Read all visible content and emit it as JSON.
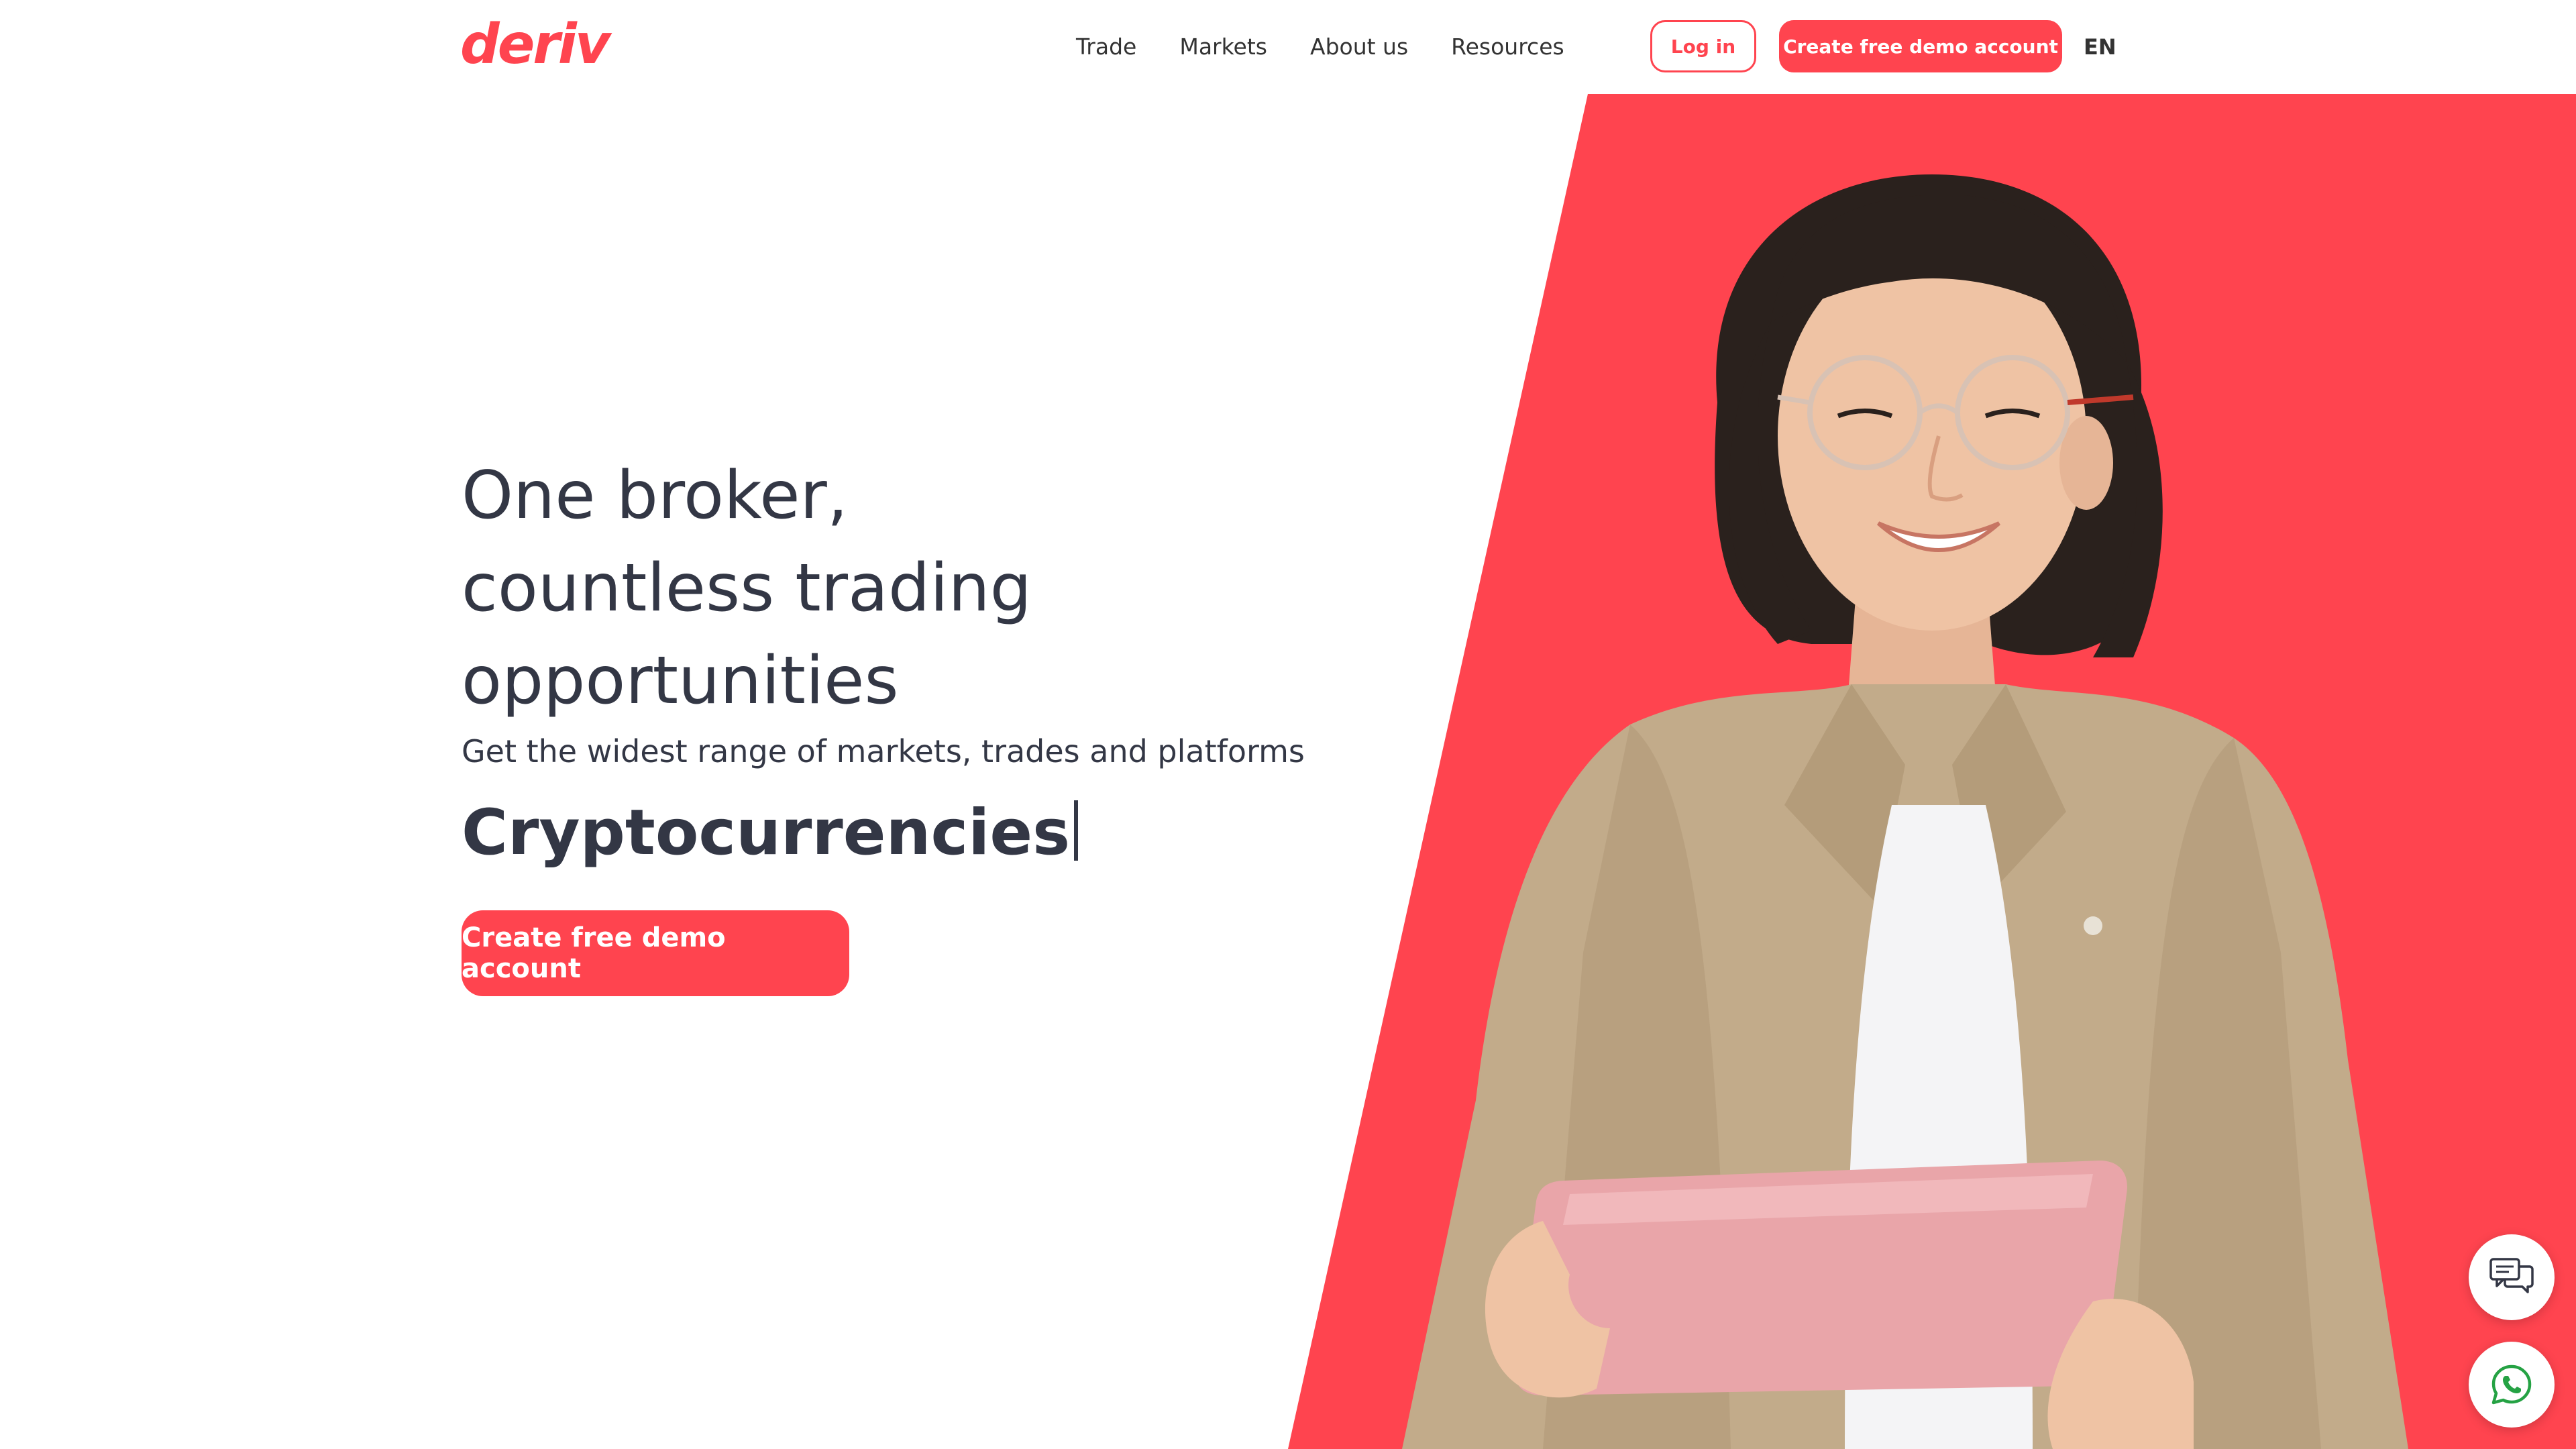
{
  "header": {
    "logo_text": "deriv",
    "nav": [
      "Trade",
      "Markets",
      "About us",
      "Resources"
    ],
    "login_label": "Log in",
    "demo_label": "Create free demo account",
    "language": "EN"
  },
  "hero": {
    "title_lines": [
      "One broker,",
      "countless trading",
      "opportunities"
    ],
    "subtitle": "Get the widest range of markets, trades and platforms",
    "rotating_text": "Cryptocurrencies",
    "cta_label": "Create free demo account"
  },
  "colors": {
    "brand": "#ff444f",
    "text": "#333745",
    "background": "#ffffff"
  },
  "icons": {
    "chat": "chat-bubbles-icon",
    "whatsapp": "whatsapp-icon"
  }
}
